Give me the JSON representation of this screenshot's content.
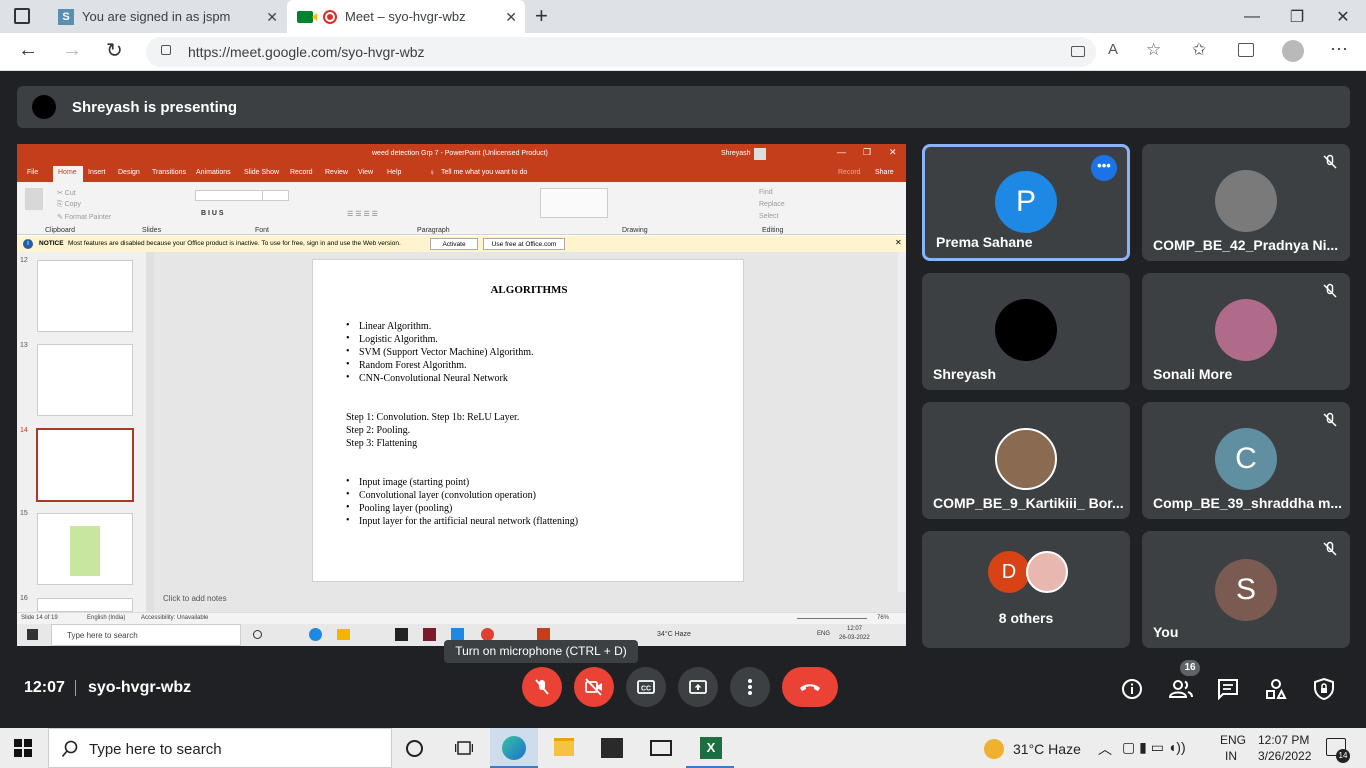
{
  "browser": {
    "tabs": [
      {
        "title": "You are signed in as jspm"
      },
      {
        "title": "Meet – syo-hvgr-wbz"
      }
    ],
    "url": "https://meet.google.com/syo-hvgr-wbz"
  },
  "meet": {
    "presenting": "Shreyash is presenting",
    "time": "12:07",
    "meeting_code": "syo-hvgr-wbz",
    "tooltip": "Turn on microphone (CTRL + D)",
    "people_count": "16",
    "participants": [
      {
        "name": "Prema Sahane",
        "initial": "P",
        "color": "#1e88e5"
      },
      {
        "name": "COMP_BE_42_Pradnya Ni...",
        "initial": "",
        "color": "#7a7a7a"
      },
      {
        "name": "Shreyash",
        "initial": "",
        "color": "#000000"
      },
      {
        "name": "Sonali More",
        "initial": "",
        "color": "#b06a8a"
      },
      {
        "name": "COMP_BE_9_Kartikiii_ Bor...",
        "initial": "",
        "color": "#8a6a50"
      },
      {
        "name": "Comp_BE_39_shraddha m...",
        "initial": "C",
        "color": "#5f8fa0"
      },
      {
        "name": "8 others",
        "initial": "D",
        "color": "#d84315"
      },
      {
        "name": "You",
        "initial": "S",
        "color": "#7b5a52"
      }
    ]
  },
  "ppt": {
    "title": "weed detection Grp 7  -  PowerPoint (Unlicensed Product)",
    "user": "Shreyash",
    "tabs": [
      "File",
      "Home",
      "Insert",
      "Design",
      "Transitions",
      "Animations",
      "Slide Show",
      "Record",
      "Review",
      "View",
      "Help"
    ],
    "tell": "Tell me what you want to do",
    "record": "Record",
    "share": "Share",
    "groups": [
      "Clipboard",
      "Slides",
      "Font",
      "Paragraph",
      "Drawing",
      "Editing"
    ],
    "notice_label": "NOTICE",
    "notice": "Most features are disabled because your Office product is inactive. To use for free, sign in and use the Web version.",
    "activate": "Activate",
    "use_free": "Use free at Office.com",
    "thumb_numbers": [
      "12",
      "13",
      "14",
      "15",
      "16"
    ],
    "notes": "Click to add notes",
    "status_slide": "Slide 14 of 19",
    "status_lang": "English (India)",
    "status_access": "Accessibility: Unavailable",
    "zoom": "76%",
    "slide": {
      "title": "ALGORITHMS",
      "bullets1": [
        "Linear Algorithm.",
        "Logistic Algorithm.",
        "SVM (Support Vector Machine) Algorithm.",
        "Random Forest Algorithm.",
        "CNN-Convolutional Neural Network"
      ],
      "steps": [
        "Step 1: Convolution. Step 1b: ReLU Layer.",
        "Step 2: Pooling.",
        "Step 3: Flattening"
      ],
      "bullets2": [
        "Input image (starting point)",
        "Convolutional layer (convolution operation)",
        "Pooling layer (pooling)",
        "Input layer for the artificial neural network (flattening)"
      ]
    },
    "inner_taskbar": {
      "search": "Type here to search",
      "weather": "34°C  Haze",
      "lang": "ENG",
      "time": "12:07",
      "date": "26-03-2022"
    }
  },
  "taskbar": {
    "search": "Type here to search",
    "weather": "31°C  Haze",
    "lang1": "ENG",
    "lang2": "IN",
    "time": "12:07 PM",
    "date": "3/26/2022",
    "notif": "14"
  },
  "colors": {
    "meet_bg": "#202124",
    "tile": "#3c4043",
    "end_call": "#ea4335",
    "ppt_accent": "#c43e1c"
  }
}
